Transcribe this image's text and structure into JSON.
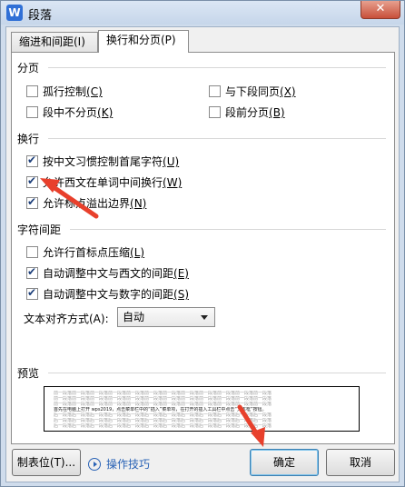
{
  "window": {
    "title": "段落",
    "app_icon_letter": "W",
    "close_label": "✕"
  },
  "tabs": [
    {
      "label": "缩进和间距(I)"
    },
    {
      "label": "换行和分页(P)"
    }
  ],
  "sections": {
    "pagination": "分页",
    "line_break": "换行",
    "char_spacing": "字符间距",
    "preview": "预览"
  },
  "options": {
    "widow_control": {
      "label": "孤行控制",
      "key": "(C)",
      "checked": false
    },
    "keep_with_next": {
      "label": "与下段同页",
      "key": "(X)",
      "checked": false
    },
    "keep_lines": {
      "label": "段中不分页",
      "key": "(K)",
      "checked": false
    },
    "page_break_before": {
      "label": "段前分页",
      "key": "(B)",
      "checked": false
    },
    "chinese_rules": {
      "label": "按中文习惯控制首尾字符",
      "key": "(U)",
      "checked": true
    },
    "western_wrap": {
      "label": "允许西文在单词中间换行",
      "key": "(W)",
      "checked": true
    },
    "hanging_punct": {
      "label": "允许标点溢出边界",
      "key": "(N)",
      "checked": true
    },
    "compress_punct": {
      "label": "允许行首标点压缩",
      "key": "(L)",
      "checked": false
    },
    "auto_space_western": {
      "label": "自动调整中文与西文的间距",
      "key": "(E)",
      "checked": true
    },
    "auto_space_number": {
      "label": "自动调整中文与数字的间距",
      "key": "(S)",
      "checked": true
    }
  },
  "text_align": {
    "label": "文本对齐方式(A):",
    "value": "自动"
  },
  "preview": {
    "filler": "前一段落前一段落前一段落前一段落前一段落前一段落前一段落前一段落前一段落前一段落前一段落前一段落",
    "sample": "首先在电脑上打开 wps2019，点击菜单栏中的“插入”菜单项，在打开的插入工具栏中点击“文本框”按钮。",
    "after": "后一段落后一段落后一段落后一段落后一段落后一段落后一段落后一段落后一段落后一段落后一段落后一段落"
  },
  "buttons": {
    "tabs_stop": "制表位(T)...",
    "tips": "操作技巧",
    "ok": "确定",
    "cancel": "取消"
  },
  "colors": {
    "arrow": "#e8402c",
    "link": "#2a63b6"
  }
}
